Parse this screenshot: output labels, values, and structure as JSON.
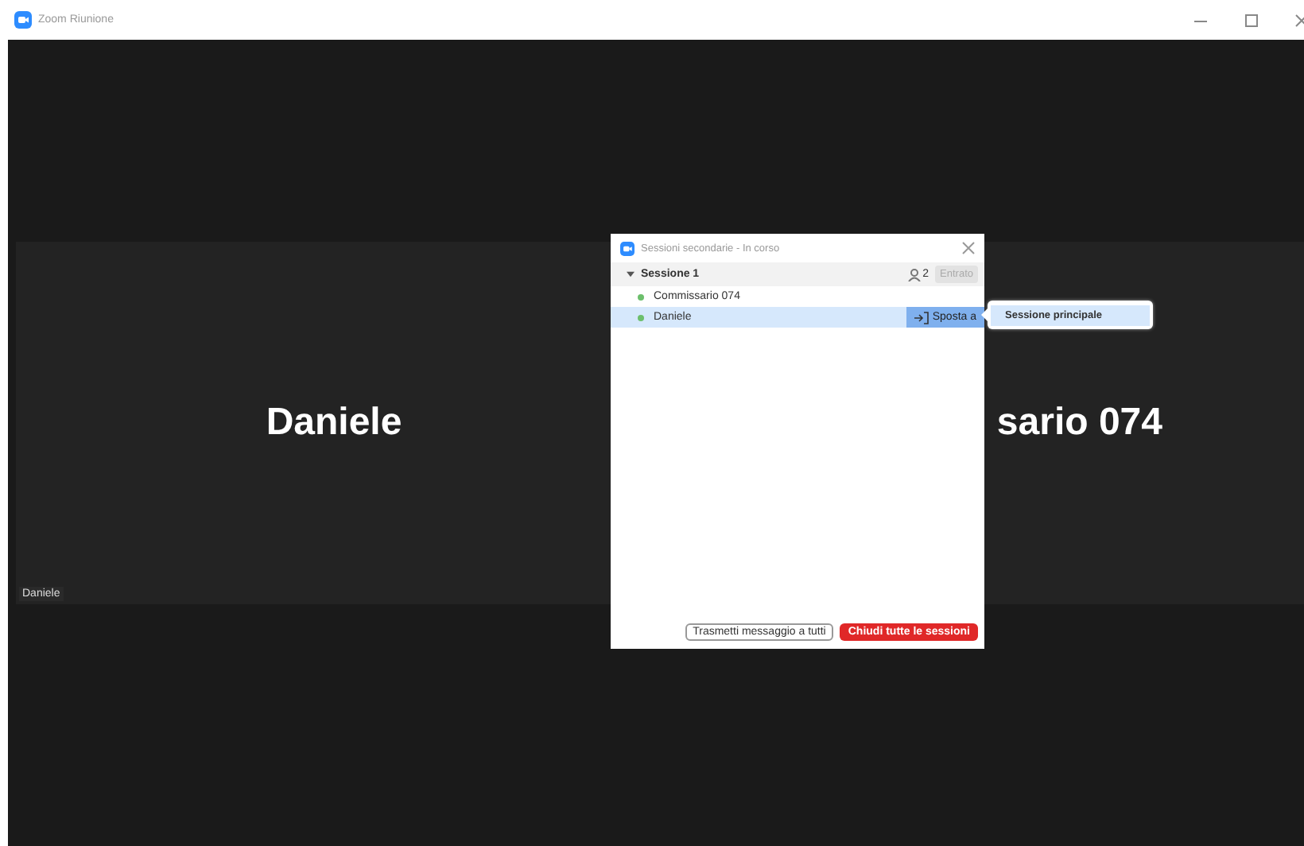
{
  "window": {
    "title": "Zoom Riunione"
  },
  "tiles": [
    {
      "name": "Daniele",
      "label": "Daniele"
    },
    {
      "name": "sario 074"
    }
  ],
  "dialog": {
    "title": "Sessioni secondarie - In corso",
    "sessions": [
      {
        "name": "Sessione 1",
        "expanded": true,
        "count": "2",
        "join_label": "Entrato",
        "join_disabled": true,
        "participants": [
          {
            "name": "Commissario 074",
            "selected": false,
            "color": "#6cbf6c"
          },
          {
            "name": "Daniele",
            "selected": true,
            "color": "#6cbf6c",
            "action": "Sposta a"
          }
        ]
      }
    ],
    "menu": [
      "Sessione principale"
    ],
    "buttons": [
      {
        "label": "Trasmetti messaggio a tutti",
        "kind": "secondary"
      },
      {
        "label": "Chiudi tutte le sessioni",
        "kind": "danger"
      }
    ]
  }
}
